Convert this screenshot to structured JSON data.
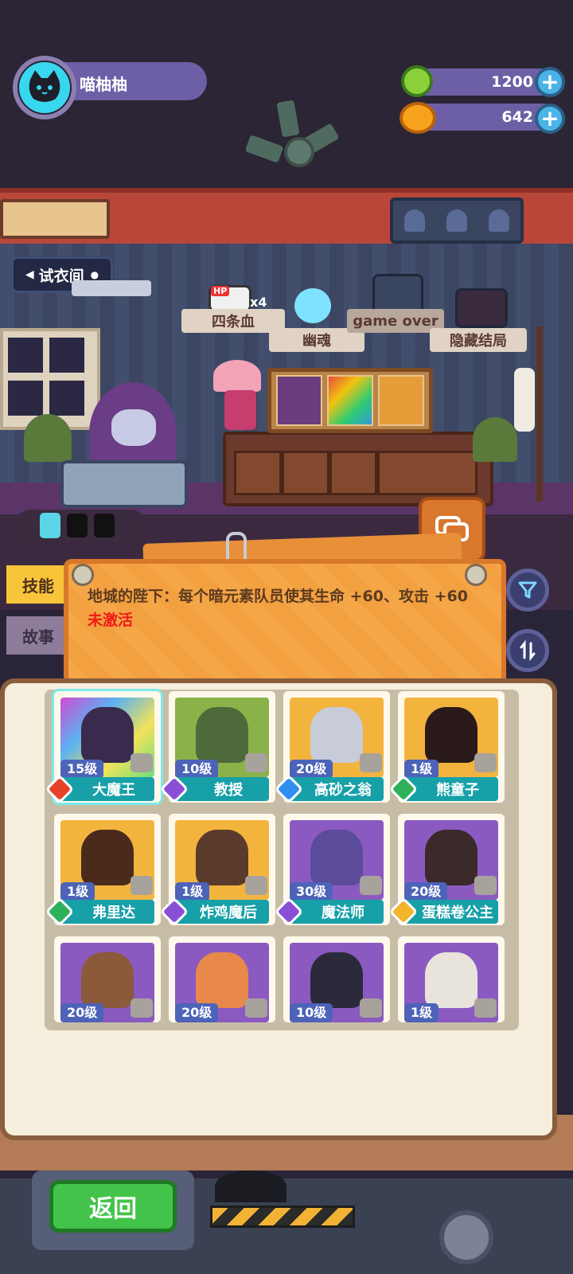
{
  "player": {
    "name": "喵柚柚",
    "avatar_icon": "cat-face-icon"
  },
  "currency": {
    "gems": "1200",
    "coins": "642",
    "gem_icon": "green-gem-icon",
    "coin_icon": "gold-planet-icon"
  },
  "room": {
    "tag": "试衣间"
  },
  "endings": [
    {
      "label": "四条血",
      "badge": "HP",
      "multiplier": "x4"
    },
    {
      "label": "幽魂"
    },
    {
      "label": "game over"
    },
    {
      "label": "隐藏结局"
    }
  ],
  "tabs": {
    "skill": "技能",
    "story": "故事"
  },
  "skill_info": {
    "text": "地城的陛下：每个暗元素队员使其生命 +60、攻击 +60",
    "status": "未激活"
  },
  "characters": [
    {
      "level": "15级",
      "name": "大魔王",
      "element": "red",
      "art": "rainbow",
      "figure": "#3a2a4e",
      "selected": true
    },
    {
      "level": "10级",
      "name": "教授",
      "element": "purple",
      "art": "green",
      "figure": "#4e6a3a"
    },
    {
      "level": "20级",
      "name": "高砂之翁",
      "element": "blue",
      "art": "gold",
      "figure": "#c8ccd8"
    },
    {
      "level": "1级",
      "name": "熊童子",
      "element": "green",
      "art": "gold",
      "figure": "#2a1a1a"
    },
    {
      "level": "1级",
      "name": "弗里达",
      "element": "green",
      "art": "gold",
      "figure": "#4a2a1a"
    },
    {
      "level": "1级",
      "name": "炸鸡魔后",
      "element": "purple",
      "art": "gold",
      "figure": "#5a3a2a"
    },
    {
      "level": "30级",
      "name": "魔法师",
      "element": "purple",
      "art": "purple",
      "figure": "#5b4b9a"
    },
    {
      "level": "20级",
      "name": "蛋糕卷公主",
      "element": "yellow",
      "art": "purple",
      "figure": "#3a2a2a"
    },
    {
      "level": "20级",
      "name": "",
      "element": "",
      "art": "purple",
      "figure": "#8a5a3a"
    },
    {
      "level": "20级",
      "name": "",
      "element": "",
      "art": "purple",
      "figure": "#e8884a"
    },
    {
      "level": "10级",
      "name": "",
      "element": "",
      "art": "purple",
      "figure": "#2a2a3a"
    },
    {
      "level": "1级",
      "name": "",
      "element": "",
      "art": "purple",
      "figure": "#e8e4dc"
    }
  ],
  "buttons": {
    "back": "返回",
    "filter_icon": "filter-icon",
    "sort_icon": "sort-icon",
    "chat_icon": "chat-icon"
  }
}
